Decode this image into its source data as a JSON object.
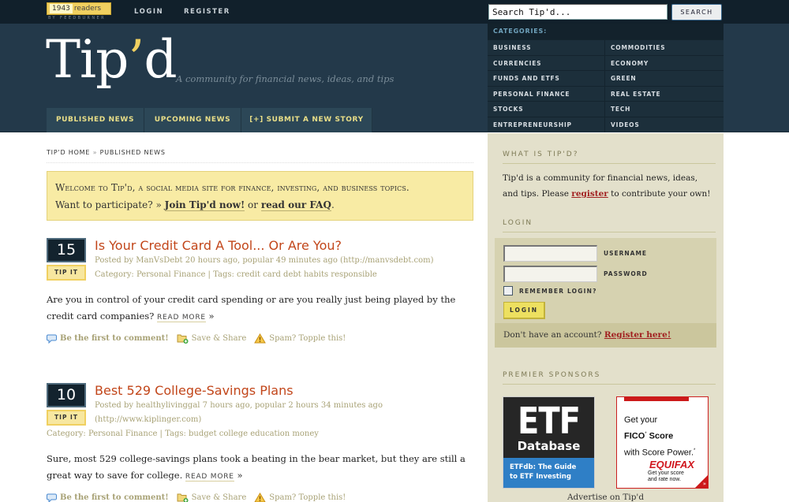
{
  "topbar": {
    "feed_count": "1943",
    "feed_unit": "readers",
    "feed_by": "BY FEEDBURNER",
    "login": "LOGIN",
    "register": "REGISTER",
    "search_placeholder": "Search Tip'd...",
    "search_value": "Search Tip'd...",
    "search_button": "SEARCH"
  },
  "header": {
    "logo_main": "Tip",
    "logo_apos": "’",
    "logo_end": "d",
    "tagline": "A community for financial news, ideas, and tips",
    "nav": [
      {
        "label": "PUBLISHED NEWS"
      },
      {
        "label": "UPCOMING NEWS"
      },
      {
        "label": "[+] SUBMIT A NEW STORY"
      }
    ]
  },
  "categories": {
    "heading": "CATEGORIES:",
    "items": [
      "BUSINESS",
      "COMMODITIES",
      "CURRENCIES",
      "ECONOMY",
      "FUNDS AND ETFS",
      "GREEN",
      "PERSONAL FINANCE",
      "REAL ESTATE",
      "STOCKS",
      "TECH",
      "ENTREPRENEURSHIP",
      "VIDEOS"
    ]
  },
  "breadcrumb": {
    "home": "TIP'D HOME",
    "sep": " » ",
    "current": "PUBLISHED NEWS"
  },
  "welcome": {
    "line1": "Welcome to Tip'd, a social media site for finance, investing, and business topics.",
    "prompt": "Want to participate? » ",
    "join": "Join Tip'd now!",
    "or": " or ",
    "faq": "read our FAQ",
    "end": "."
  },
  "stories": [
    {
      "votes": "15",
      "tip_label": "TIP IT",
      "title": "Is Your Credit Card A Tool... Or Are You?",
      "posted": "Posted by ManVsDebt 20 hours ago, popular 49 minutes ago (http://manvsdebt.com)",
      "category": "Category: Personal Finance | Tags: credit card debt habits responsible",
      "excerpt": "Are you in control of your credit card spending or are you really just being played by the credit card companies? ",
      "read_more": "READ MORE",
      "read_more_arrow": " »",
      "comment": "Be the first to comment!",
      "share": "Save & Share",
      "spam": "Spam? Topple this!"
    },
    {
      "votes": "10",
      "tip_label": "TIP IT",
      "title": "Best 529 College-Savings Plans",
      "posted": "Posted by healthylivinggal 7 hours ago, popular 2 hours 34 minutes ago (http://www.kiplinger.com)",
      "category": "Category: Personal Finance | Tags: budget college education money",
      "excerpt": "Sure, most 529 college-savings plans took a beating in the bear market, but they are still a great way to save for college. ",
      "read_more": "READ MORE",
      "read_more_arrow": " »",
      "comment": "Be the first to comment!",
      "share": "Save & Share",
      "spam": "Spam? Topple this!"
    }
  ],
  "sidebar": {
    "what_heading": "WHAT IS TIP'D?",
    "what_text_1": "Tip'd is a community for financial news, ideas, and tips. Please ",
    "what_link": "register",
    "what_text_2": " to contribute your own!",
    "login_heading": "LOGIN",
    "username_label": "USERNAME",
    "password_label": "PASSWORD",
    "remember_label": "REMEMBER LOGIN?",
    "remember_checked": false,
    "login_button": "LOGIN",
    "no_account": "Don't have an account? ",
    "register_here": "Register here!",
    "sponsors_heading": "PREMIER SPONSORS",
    "ad1": {
      "big": "ETF",
      "sub": "Database",
      "foot_1": "ETFdb: The Guide",
      "foot_2": "to ETF Investing"
    },
    "ad2": {
      "line1": "Get your",
      "line2": "FICO",
      "line2b": " Score",
      "line3": "with Score Power.",
      "brand": "EQUIFAX",
      "small1": "Get your score",
      "small2": "and rate now.",
      "arrow": "»"
    },
    "advertise": "Advertise on Tip'd"
  }
}
